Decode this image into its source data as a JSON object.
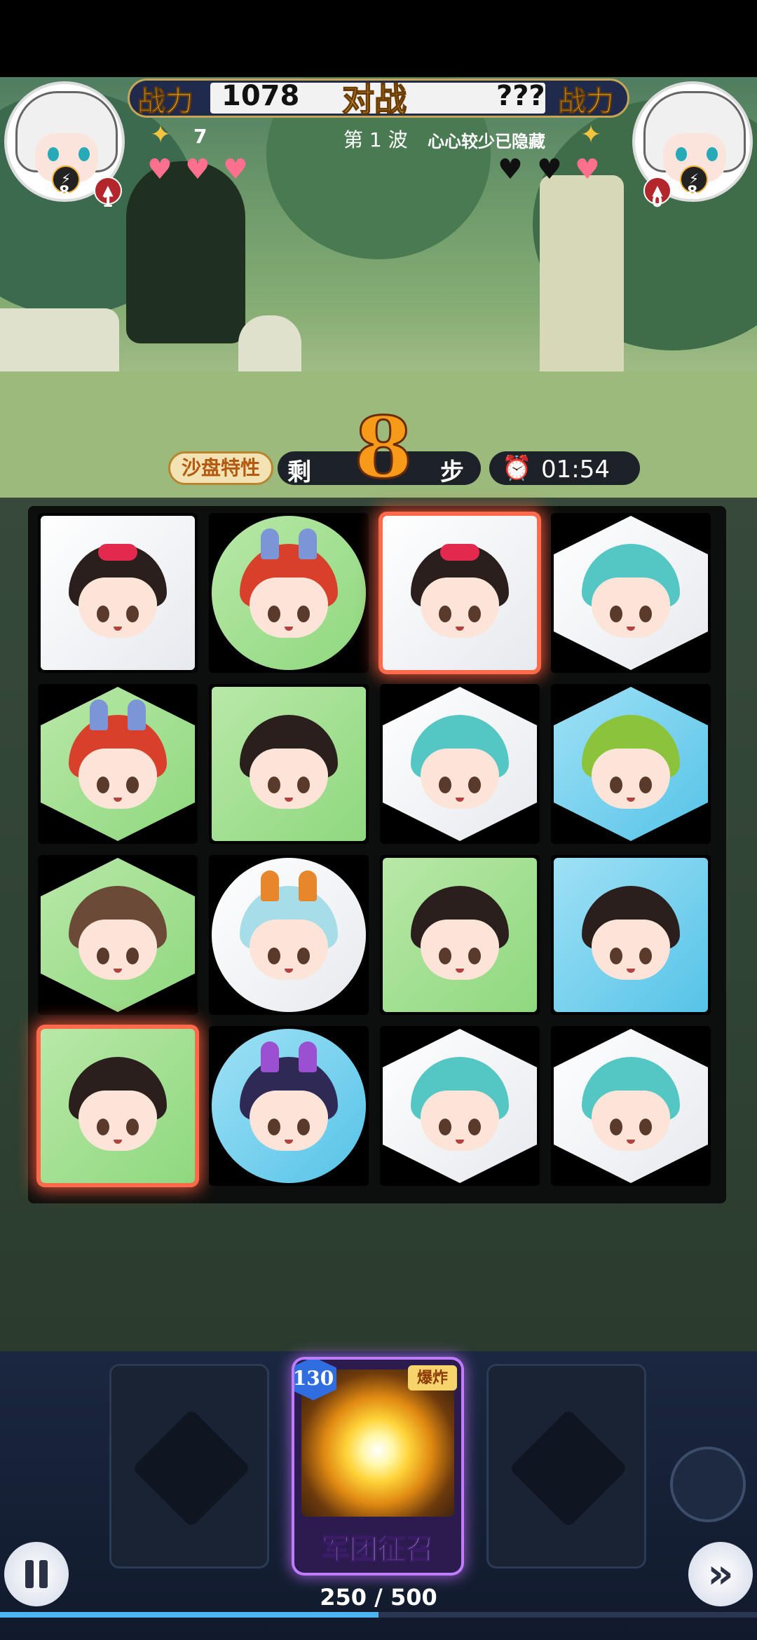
{
  "header": {
    "power_label_left": "战力",
    "power_value_left": "1078",
    "vs_label": "对战",
    "power_value_right": "???",
    "power_label_right": "战力",
    "stars": "7",
    "wave": "第 1 波",
    "notice": "心心较少已隐藏"
  },
  "player_left": {
    "level": "8",
    "count": "1",
    "hearts": [
      "pink",
      "pink",
      "pink"
    ]
  },
  "player_right": {
    "count": "0",
    "level": "8",
    "hearts": [
      "black",
      "black",
      "pink"
    ]
  },
  "steps": {
    "feature_label": "沙盘特性",
    "prefix": "剩",
    "value": "8",
    "suffix": "步",
    "timer": "01:54"
  },
  "colors": {
    "glow": "#ff5a3c",
    "accent_gold": "#f6c33c",
    "card_purple": "#c07cff"
  },
  "board": {
    "rows": [
      [
        {
          "shape": "square",
          "color": "white",
          "face": "bow-girl",
          "glow": false
        },
        {
          "shape": "circle",
          "color": "green",
          "face": "red-hair-ears",
          "glow": false
        },
        {
          "shape": "square",
          "color": "white",
          "face": "bow-girl",
          "glow": true
        },
        {
          "shape": "hex",
          "color": "white",
          "face": "teal-hair",
          "glow": false
        }
      ],
      [
        {
          "shape": "hex",
          "color": "green",
          "face": "red-hair-ears",
          "glow": true
        },
        {
          "shape": "square",
          "color": "green",
          "face": "comb-girl",
          "glow": false
        },
        {
          "shape": "hex",
          "color": "white",
          "face": "teal-hair",
          "glow": false
        },
        {
          "shape": "hex",
          "color": "blue",
          "face": "green-hair",
          "glow": false
        }
      ],
      [
        {
          "shape": "hex",
          "color": "green",
          "face": "bun-girl",
          "glow": true
        },
        {
          "shape": "circle",
          "color": "white",
          "face": "lightblue-ears",
          "glow": false
        },
        {
          "shape": "square",
          "color": "green",
          "face": "comb-girl",
          "glow": false
        },
        {
          "shape": "square",
          "color": "blue",
          "face": "flower-girl",
          "glow": false
        }
      ],
      [
        {
          "shape": "square",
          "color": "green",
          "face": "comb-girl",
          "glow": true
        },
        {
          "shape": "circle",
          "color": "blue",
          "face": "purple-ears",
          "glow": false
        },
        {
          "shape": "hex",
          "color": "white",
          "face": "teal-hair",
          "glow": false
        },
        {
          "shape": "hex",
          "color": "white",
          "face": "teal-hair",
          "glow": false
        }
      ]
    ]
  },
  "skill_card": {
    "cost": "130",
    "tag": "爆炸",
    "title": "军团征召"
  },
  "energy": {
    "text": "250 / 500",
    "fraction": 0.5
  },
  "icons": {
    "pause": "pause-icon",
    "fast_forward": "fast-forward-icon",
    "alarm": "alarm-clock-icon",
    "star": "star-icon"
  }
}
